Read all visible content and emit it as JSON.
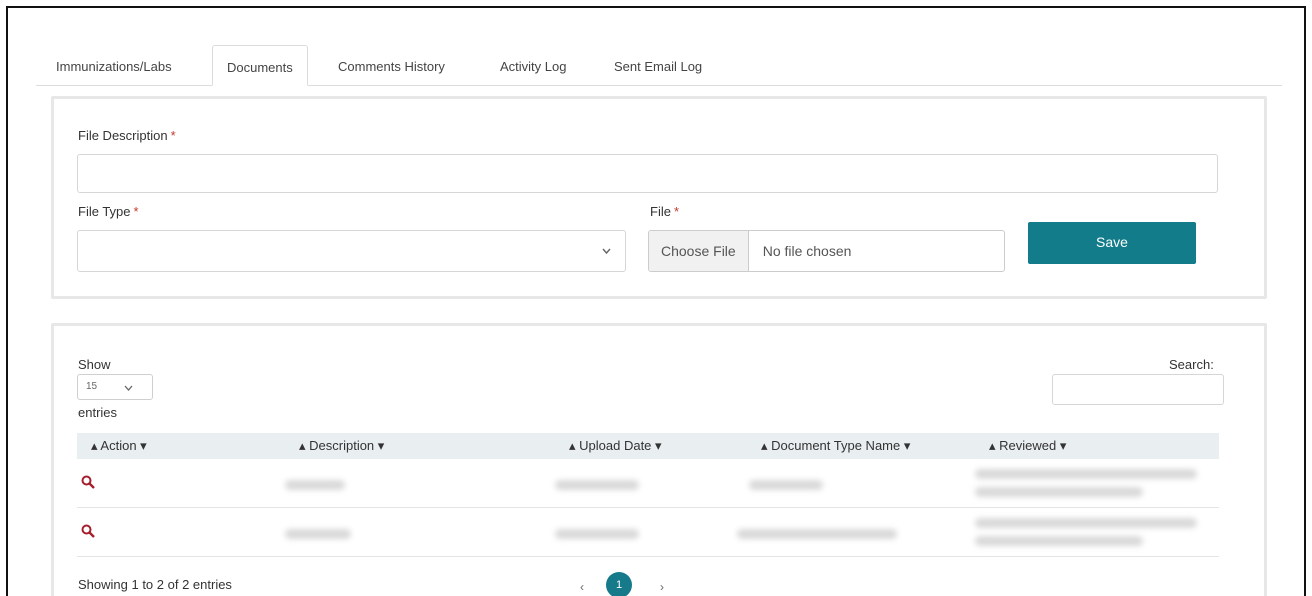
{
  "tabs": [
    {
      "label": "Immunizations/Labs"
    },
    {
      "label": "Documents"
    },
    {
      "label": "Comments History"
    },
    {
      "label": "Activity Log"
    },
    {
      "label": "Sent Email Log"
    }
  ],
  "form": {
    "file_description_label": "File Description",
    "file_description_value": "",
    "file_type_label": "File Type",
    "file_type_value": "",
    "file_label": "File",
    "choose_file_label": "Choose File",
    "no_file_text": "No file chosen",
    "required_mark": "*",
    "save_label": "Save"
  },
  "table": {
    "show_label": "Show",
    "page_size": "15",
    "entries_label": "entries",
    "search_label": "Search:",
    "search_value": "",
    "columns": [
      "Action",
      "Description",
      "Upload Date",
      "Document Type Name",
      "Reviewed"
    ],
    "rows": [
      {
        "action": "view"
      },
      {
        "action": "view"
      }
    ],
    "info": "Showing 1 to 2 of 2 entries",
    "current_page": "1",
    "prev_label": "‹",
    "next_label": "›"
  },
  "colors": {
    "accent": "#127c8a",
    "required": "#c0392b",
    "icon": "#a31f2d"
  }
}
